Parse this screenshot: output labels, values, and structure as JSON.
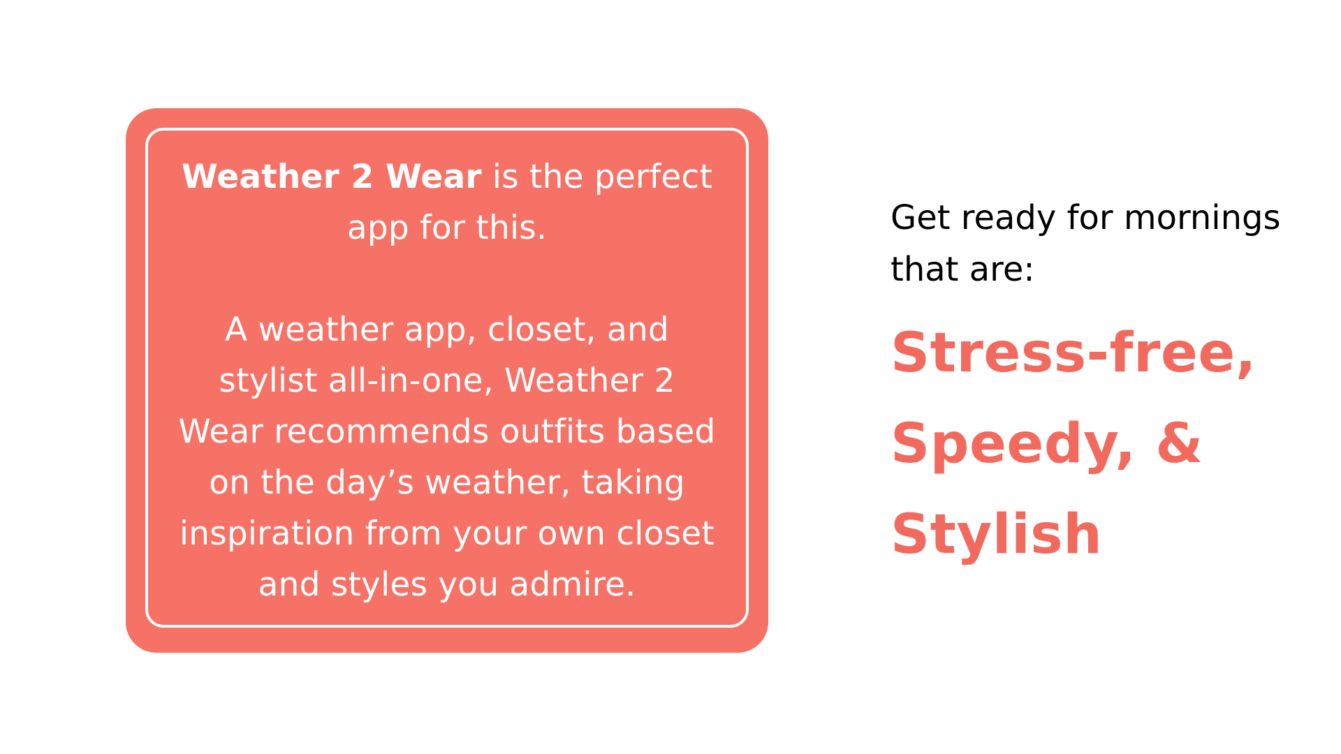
{
  "colors": {
    "background": "#ffffff",
    "card": "#f67166",
    "card_border": "#ffffff",
    "accent_text": "#f26a5e",
    "body_text": "#000000"
  },
  "card": {
    "brand": "Weather 2 Wear",
    "intro_suffix": " is the perfect app for this.",
    "description": "A weather app, closet, and stylist all-in-one, Weather 2 Wear recommends outfits based on the day’s weather, taking inspiration from your own closet and styles you admire."
  },
  "right": {
    "tagline": "Get ready for mornings that are:",
    "traits": [
      "Stress-free,",
      "Speedy, &",
      "Stylish"
    ]
  }
}
